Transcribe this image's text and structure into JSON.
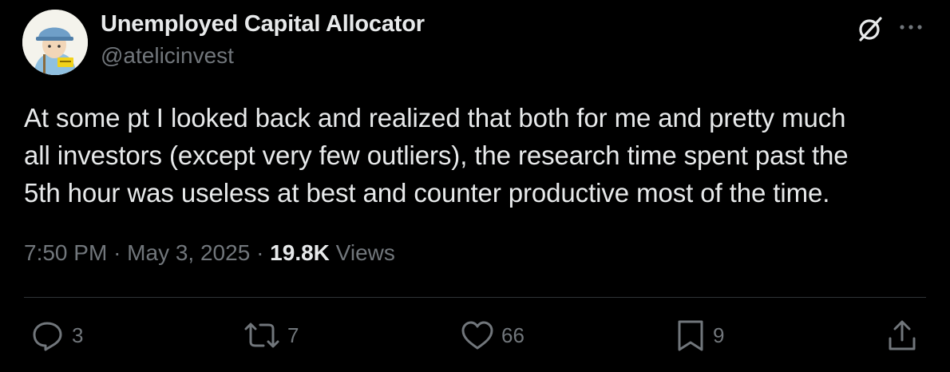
{
  "author": {
    "display_name": "Unemployed Capital Allocator",
    "handle": "@atelicinvest",
    "avatar": "cartoon-avatar"
  },
  "header_icons": [
    "grok-icon",
    "more-icon"
  ],
  "post": {
    "text": "At some pt I looked back and realized that both for me and pretty much\nall investors (except very few outliers), the research time spent past the\n5th hour was useless at best and counter productive most of the time.",
    "time": "7:50 PM",
    "separator": "·",
    "date": "May 3, 2025",
    "views_count": "19.8K",
    "views_label": "Views"
  },
  "actions": {
    "reply": {
      "icon": "reply-icon",
      "count": "3"
    },
    "repost": {
      "icon": "repost-icon",
      "count": "7"
    },
    "like": {
      "icon": "heart-icon",
      "count": "66"
    },
    "bookmark": {
      "icon": "bookmark-icon",
      "count": "9"
    },
    "share": {
      "icon": "share-icon"
    }
  },
  "colors": {
    "background": "#000000",
    "primary_text": "#e7e9ea",
    "secondary_text": "#71767b",
    "divider": "#2f3336"
  }
}
